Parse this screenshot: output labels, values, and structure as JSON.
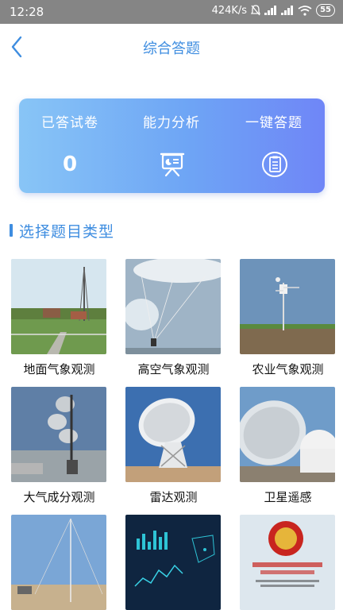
{
  "status": {
    "time": "12:28",
    "speed": "424K/s",
    "battery": "55"
  },
  "header": {
    "title": "综合答题"
  },
  "summary": {
    "answered_label": "已答试卷",
    "answered_value": "0",
    "ability_label": "能力分析",
    "quick_label": "一键答题"
  },
  "section": {
    "title": "选择题目类型"
  },
  "categories": [
    {
      "label": "地面气象观测"
    },
    {
      "label": "高空气象观测"
    },
    {
      "label": "农业气象观测"
    },
    {
      "label": "大气成分观测"
    },
    {
      "label": "雷达观测"
    },
    {
      "label": "卫星遥感"
    }
  ],
  "colors": {
    "accent": "#3e8de0",
    "card_start": "#88c5f6",
    "card_end": "#6f86f7"
  }
}
